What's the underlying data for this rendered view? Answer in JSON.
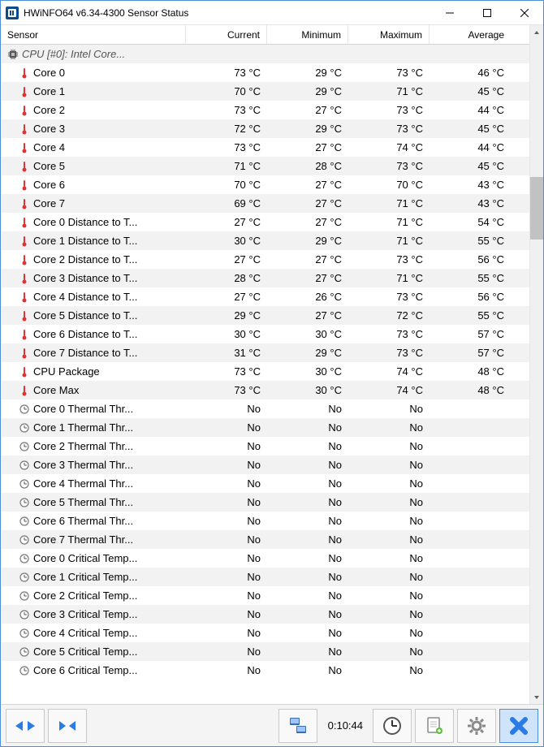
{
  "title": "HWiNFO64 v6.34-4300 Sensor Status",
  "headers": {
    "sensor": "Sensor",
    "current": "Current",
    "minimum": "Minimum",
    "maximum": "Maximum",
    "average": "Average"
  },
  "group_label": "CPU [#0]: Intel Core...",
  "toolbar_time": "0:10:44",
  "rows": [
    {
      "icon": "therm",
      "name": "Core 0",
      "cur": "73 °C",
      "min": "29 °C",
      "max": "73 °C",
      "avg": "46 °C"
    },
    {
      "icon": "therm",
      "name": "Core 1",
      "cur": "70 °C",
      "min": "29 °C",
      "max": "71 °C",
      "avg": "45 °C"
    },
    {
      "icon": "therm",
      "name": "Core 2",
      "cur": "73 °C",
      "min": "27 °C",
      "max": "73 °C",
      "avg": "44 °C"
    },
    {
      "icon": "therm",
      "name": "Core 3",
      "cur": "72 °C",
      "min": "29 °C",
      "max": "73 °C",
      "avg": "45 °C"
    },
    {
      "icon": "therm",
      "name": "Core 4",
      "cur": "73 °C",
      "min": "27 °C",
      "max": "74 °C",
      "avg": "44 °C"
    },
    {
      "icon": "therm",
      "name": "Core 5",
      "cur": "71 °C",
      "min": "28 °C",
      "max": "73 °C",
      "avg": "45 °C"
    },
    {
      "icon": "therm",
      "name": "Core 6",
      "cur": "70 °C",
      "min": "27 °C",
      "max": "70 °C",
      "avg": "43 °C"
    },
    {
      "icon": "therm",
      "name": "Core 7",
      "cur": "69 °C",
      "min": "27 °C",
      "max": "71 °C",
      "avg": "43 °C"
    },
    {
      "icon": "therm",
      "name": "Core 0 Distance to T...",
      "cur": "27 °C",
      "min": "27 °C",
      "max": "71 °C",
      "avg": "54 °C"
    },
    {
      "icon": "therm",
      "name": "Core 1 Distance to T...",
      "cur": "30 °C",
      "min": "29 °C",
      "max": "71 °C",
      "avg": "55 °C"
    },
    {
      "icon": "therm",
      "name": "Core 2 Distance to T...",
      "cur": "27 °C",
      "min": "27 °C",
      "max": "73 °C",
      "avg": "56 °C"
    },
    {
      "icon": "therm",
      "name": "Core 3 Distance to T...",
      "cur": "28 °C",
      "min": "27 °C",
      "max": "71 °C",
      "avg": "55 °C"
    },
    {
      "icon": "therm",
      "name": "Core 4 Distance to T...",
      "cur": "27 °C",
      "min": "26 °C",
      "max": "73 °C",
      "avg": "56 °C"
    },
    {
      "icon": "therm",
      "name": "Core 5 Distance to T...",
      "cur": "29 °C",
      "min": "27 °C",
      "max": "72 °C",
      "avg": "55 °C"
    },
    {
      "icon": "therm",
      "name": "Core 6 Distance to T...",
      "cur": "30 °C",
      "min": "30 °C",
      "max": "73 °C",
      "avg": "57 °C"
    },
    {
      "icon": "therm",
      "name": "Core 7 Distance to T...",
      "cur": "31 °C",
      "min": "29 °C",
      "max": "73 °C",
      "avg": "57 °C"
    },
    {
      "icon": "therm",
      "name": "CPU Package",
      "cur": "73 °C",
      "min": "30 °C",
      "max": "74 °C",
      "avg": "48 °C"
    },
    {
      "icon": "therm",
      "name": "Core Max",
      "cur": "73 °C",
      "min": "30 °C",
      "max": "74 °C",
      "avg": "48 °C"
    },
    {
      "icon": "clock",
      "name": "Core 0 Thermal Thr...",
      "cur": "No",
      "min": "No",
      "max": "No",
      "avg": ""
    },
    {
      "icon": "clock",
      "name": "Core 1 Thermal Thr...",
      "cur": "No",
      "min": "No",
      "max": "No",
      "avg": ""
    },
    {
      "icon": "clock",
      "name": "Core 2 Thermal Thr...",
      "cur": "No",
      "min": "No",
      "max": "No",
      "avg": ""
    },
    {
      "icon": "clock",
      "name": "Core 3 Thermal Thr...",
      "cur": "No",
      "min": "No",
      "max": "No",
      "avg": ""
    },
    {
      "icon": "clock",
      "name": "Core 4 Thermal Thr...",
      "cur": "No",
      "min": "No",
      "max": "No",
      "avg": ""
    },
    {
      "icon": "clock",
      "name": "Core 5 Thermal Thr...",
      "cur": "No",
      "min": "No",
      "max": "No",
      "avg": ""
    },
    {
      "icon": "clock",
      "name": "Core 6 Thermal Thr...",
      "cur": "No",
      "min": "No",
      "max": "No",
      "avg": ""
    },
    {
      "icon": "clock",
      "name": "Core 7 Thermal Thr...",
      "cur": "No",
      "min": "No",
      "max": "No",
      "avg": ""
    },
    {
      "icon": "clock",
      "name": "Core 0 Critical Temp...",
      "cur": "No",
      "min": "No",
      "max": "No",
      "avg": ""
    },
    {
      "icon": "clock",
      "name": "Core 1 Critical Temp...",
      "cur": "No",
      "min": "No",
      "max": "No",
      "avg": ""
    },
    {
      "icon": "clock",
      "name": "Core 2 Critical Temp...",
      "cur": "No",
      "min": "No",
      "max": "No",
      "avg": ""
    },
    {
      "icon": "clock",
      "name": "Core 3 Critical Temp...",
      "cur": "No",
      "min": "No",
      "max": "No",
      "avg": ""
    },
    {
      "icon": "clock",
      "name": "Core 4 Critical Temp...",
      "cur": "No",
      "min": "No",
      "max": "No",
      "avg": ""
    },
    {
      "icon": "clock",
      "name": "Core 5 Critical Temp...",
      "cur": "No",
      "min": "No",
      "max": "No",
      "avg": ""
    },
    {
      "icon": "clock",
      "name": "Core 6 Critical Temp...",
      "cur": "No",
      "min": "No",
      "max": "No",
      "avg": ""
    }
  ]
}
